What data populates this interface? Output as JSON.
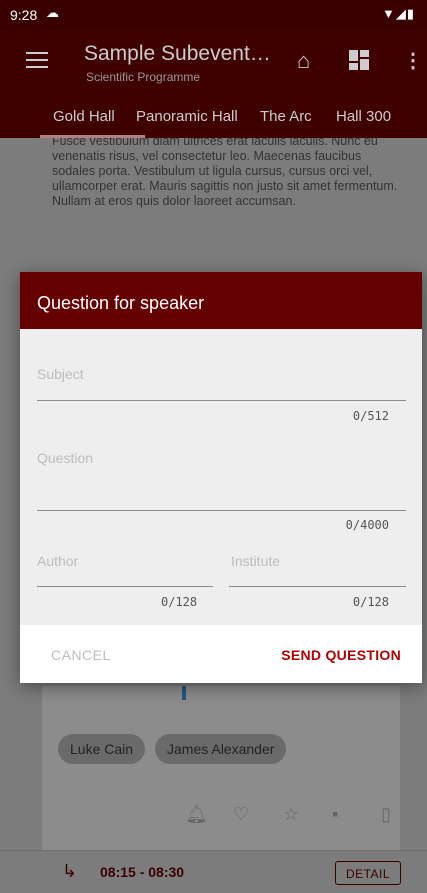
{
  "status_bar": {
    "time": "9:28",
    "cloud_icon": "cloud-icon",
    "icons": [
      "wifi-icon",
      "signal-icon",
      "battery-icon"
    ]
  },
  "app_bar": {
    "menu_icon": "menu-icon",
    "title": "Sample Subevent…",
    "subtitle": "Scientific Programme",
    "home_icon": "home-icon",
    "dashboard_icon": "dashboard-icon",
    "more_icon": "more-vert-icon"
  },
  "tabs": [
    {
      "label": "Gold Hall",
      "selected": true
    },
    {
      "label": "Panoramic Hall",
      "selected": false
    },
    {
      "label": "The Arc",
      "selected": false
    },
    {
      "label": "Hall 300",
      "selected": false
    }
  ],
  "content": {
    "body_text": "Fusce vestibulum diam ultrices erat iaculis iaculis. Nunc eu venenatis risus, vel consectetur leo. Maecenas faucibus sodales porta. Vestibulum ut ligula cursus, cursus orci vel, ullamcorper erat. Mauris sagittis non justo sit amet fermentum. Nullam at eros quis dolor laoreet accumsan.",
    "speakers": [
      "Luke Cain",
      "James Alexander"
    ],
    "action_icons": [
      "bell-icon",
      "heart-icon",
      "star-icon",
      "chat-icon",
      "clipboard-icon"
    ],
    "next_session": {
      "time": "08:15 - 08:30",
      "detail_label": "DETAIL"
    }
  },
  "dialog": {
    "title": "Question for speaker",
    "subject": {
      "placeholder": "Subject",
      "counter": "0/512"
    },
    "question": {
      "placeholder": "Question",
      "counter": "0/4000"
    },
    "author": {
      "placeholder": "Author",
      "counter": "0/128"
    },
    "institute": {
      "placeholder": "Institute",
      "counter": "0/128"
    },
    "cancel_label": "CANCEL",
    "send_label": "SEND QUESTION"
  },
  "colors": {
    "brand_dark": "#3f0000",
    "dialog_header": "#640000",
    "accent": "#b00000"
  }
}
